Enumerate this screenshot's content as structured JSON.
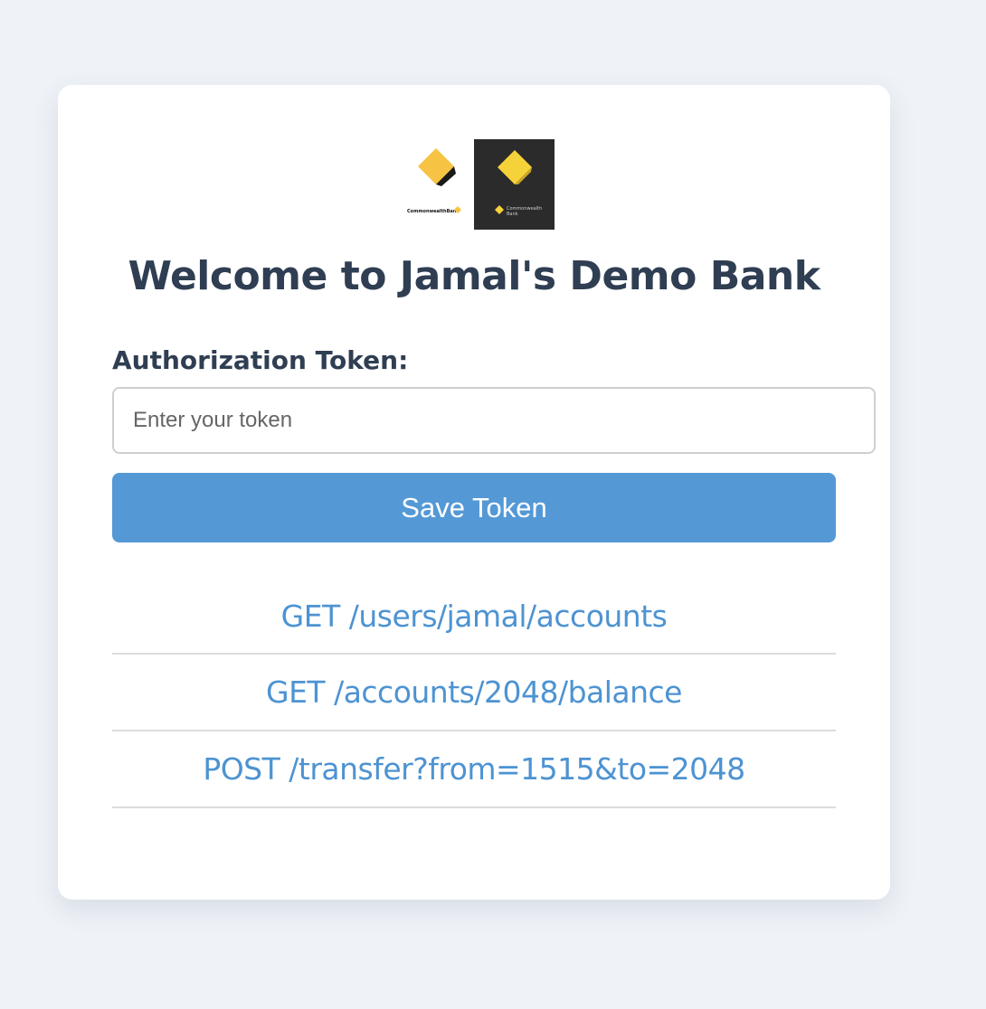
{
  "logos": {
    "light_brand_text": "CommonwealthBank",
    "dark_brand_text": "Commonwealth Bank"
  },
  "colors": {
    "page_background": "#eff3f8",
    "title": "#2f3e52",
    "button": "#5499d6",
    "link": "#4d93d2",
    "logo_yellow": "#f6c343"
  },
  "header": {
    "title": "Welcome to Jamal's Demo Bank"
  },
  "token_form": {
    "label": "Authorization Token:",
    "value": "",
    "placeholder": "Enter your token",
    "save_label": "Save Token"
  },
  "endpoints": [
    {
      "label": "GET /users/jamal/accounts"
    },
    {
      "label": "GET /accounts/2048/balance"
    },
    {
      "label": "POST /transfer?from=1515&to=2048"
    }
  ]
}
